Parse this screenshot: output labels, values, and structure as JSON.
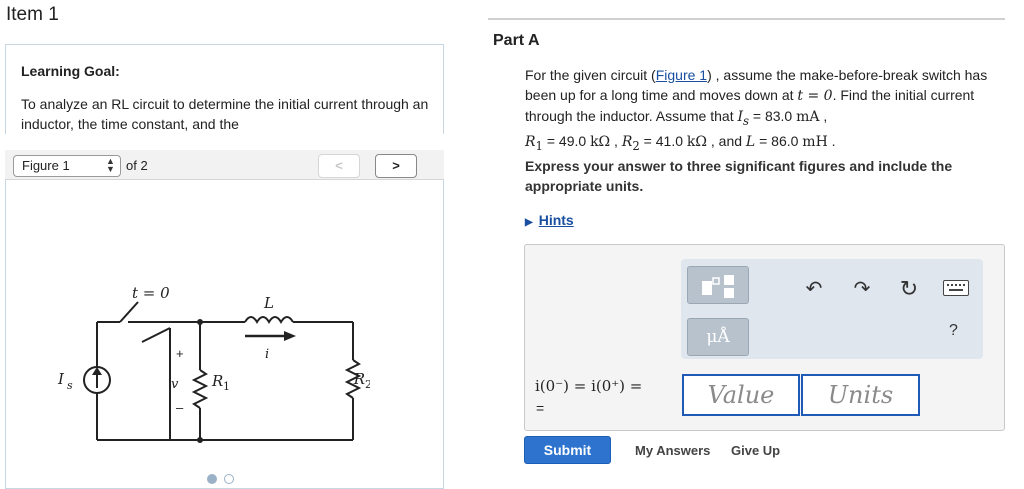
{
  "item": {
    "title": "Item 1"
  },
  "learning_goal": {
    "title": "Learning Goal:",
    "text": "To analyze an RL circuit to determine the initial current through an inductor, the time constant, and the"
  },
  "figure_nav": {
    "selected": "Figure 1",
    "of_text": "of 2",
    "prev_label": "<",
    "next_label": ">"
  },
  "circuit": {
    "switch_label": "t = 0",
    "inductor_label": "L",
    "current_label": "i",
    "source_label": "I",
    "source_subscript": "s",
    "voltage_label": "v",
    "plus": "+",
    "minus": "–",
    "r1_label": "R",
    "r1_subscript": "1",
    "r2_label": "R",
    "r2_subscript": "2"
  },
  "part": {
    "title": "Part A"
  },
  "question": {
    "p1": "For the given circuit (",
    "figure_link": "Figure 1",
    "p2": ") , assume the make-before-break switch has been up for a long time and moves down at ",
    "t_eq": "t = 0",
    "p3": ". Find the initial current through the inductor. Assume that ",
    "is_sym": "I",
    "is_sub": "s",
    "p4": " = 83.0 ",
    "is_unit": "mA",
    "p5": " , ",
    "r1_sym": "R",
    "r1_sub": "1",
    "r1_val": " = 49.0 ",
    "r1_unit": "kΩ",
    "p6": " , ",
    "r2_sym": "R",
    "r2_sub": "2",
    "r2_val": " = 41.0 ",
    "r2_unit": "kΩ",
    "p7": " , and ",
    "l_sym": "L",
    "l_val": " = 86.0 ",
    "l_unit": "mH",
    "p8": " ."
  },
  "instruction": "Express your answer to three significant figures and include the appropriate units.",
  "hints": {
    "arrow": "▶",
    "label": "Hints"
  },
  "answer": {
    "units_tool": "μÅ",
    "help": "?",
    "undo": "↶",
    "redo": "↷",
    "reset": "↻",
    "equation": "i(0⁻) = i(0⁺) =",
    "equals": "=",
    "value_placeholder": "Value",
    "units_placeholder": "Units"
  },
  "actions": {
    "submit": "Submit",
    "my_answers": "My Answers",
    "give_up": "Give Up"
  }
}
